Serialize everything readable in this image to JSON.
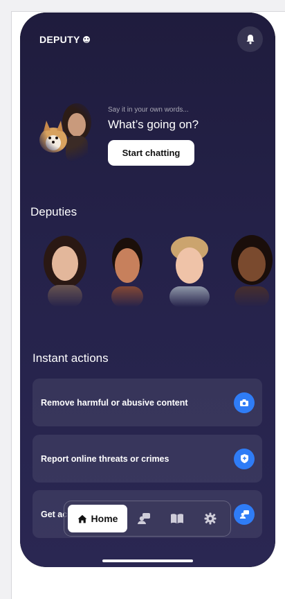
{
  "brand": {
    "name": "DEPUTY"
  },
  "colors": {
    "accent": "#2f7cf6",
    "background": "#25224a"
  },
  "hero": {
    "subtitle": "Say it in your own words...",
    "question": "What’s going on?",
    "button_label": "Start chatting"
  },
  "deputies": {
    "title": "Deputies",
    "items": [
      {
        "name": "deputy-1"
      },
      {
        "name": "deputy-2"
      },
      {
        "name": "deputy-3"
      },
      {
        "name": "deputy-4"
      }
    ]
  },
  "instant_actions": {
    "title": "Instant actions",
    "items": [
      {
        "label": "Remove harmful or abusive content",
        "icon": "camera-icon"
      },
      {
        "label": "Report online threats or crimes",
        "icon": "shield-plus-icon"
      },
      {
        "label": "Get ac",
        "icon": "chat-person-icon"
      }
    ]
  },
  "nav": {
    "home_label": "Home",
    "items": [
      "home-icon",
      "deputy-icon",
      "book-icon",
      "gear-icon"
    ]
  }
}
